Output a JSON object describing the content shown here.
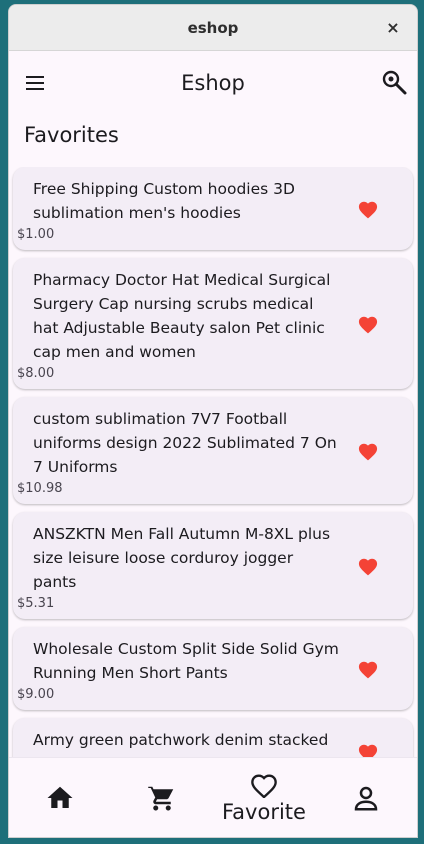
{
  "window": {
    "title": "eshop",
    "close_label": "×"
  },
  "appbar": {
    "title": "Eshop",
    "menu_icon": "menu-icon",
    "search_icon": "search-icon"
  },
  "section": {
    "title": "Favorites"
  },
  "products": [
    {
      "name": "Free Shipping Custom hoodies 3D sublimation men's hoodies",
      "price": "$1.00",
      "favorite": true
    },
    {
      "name": "Pharmacy Doctor Hat Medical Surgical Surgery Cap nursing scrubs medical hat Adjustable Beauty salon Pet clinic cap men and women",
      "price": "$8.00",
      "favorite": true
    },
    {
      "name": "custom sublimation 7V7 Football uniforms design 2022 Sublimated 7 On 7 Uniforms",
      "price": "$10.98",
      "favorite": true
    },
    {
      "name": "ANSZKTN Men Fall Autumn M-8XL plus size leisure loose corduroy jogger pants",
      "price": "$5.31",
      "favorite": true
    },
    {
      "name": "Wholesale Custom Split Side Solid Gym Running Men Short Pants",
      "price": "$9.00",
      "favorite": true
    },
    {
      "name": "Army green patchwork denim stacked jeans man elastic waist  trousers mens",
      "price": "",
      "favorite": true
    }
  ],
  "bottom_nav": {
    "items": [
      {
        "icon": "home-icon",
        "label": ""
      },
      {
        "icon": "cart-icon",
        "label": ""
      },
      {
        "icon": "heart-outline-icon",
        "label": "Favorite",
        "selected": true
      },
      {
        "icon": "person-icon",
        "label": ""
      }
    ]
  },
  "colors": {
    "heart": "#f44336",
    "card_bg": "#f3edf6",
    "page_bg": "#fdf7fd",
    "desktop_bg": "#1e6f7a"
  }
}
